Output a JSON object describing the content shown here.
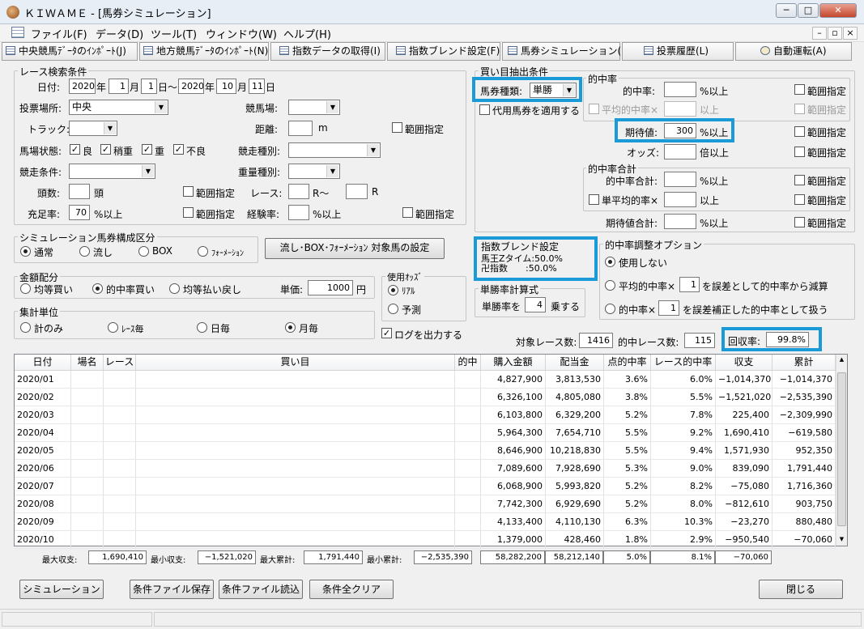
{
  "window": {
    "title": "ＫＩＷＡＭＥ - [馬券シミュレーション]",
    "minimize": "─",
    "maximize": "□",
    "close": "✕"
  },
  "menu": {
    "items": [
      "ファイル(F)",
      "データ(D)",
      "ツール(T)",
      "ウィンドウ(W)",
      "ヘルプ(H)"
    ],
    "mdi_min": "–",
    "mdi_restore": "▫",
    "mdi_close": "×"
  },
  "toolbar": {
    "items": [
      "中央競馬ﾃﾞｰﾀのｲﾝﾎﾟｰﾄ(J)",
      "地方競馬ﾃﾞｰﾀのｲﾝﾎﾟｰﾄ(N)",
      "指数データの取得(I)",
      "指数ブレンド設定(F)",
      "馬券シミュレーション(B)",
      "投票履歴(L)",
      "自動運転(A)"
    ]
  },
  "race_search": {
    "title": "レース検索条件",
    "date_label": "日付:",
    "from_year": "2020",
    "from_month": "1",
    "from_day": "1",
    "to_year": "2020",
    "to_month": "10",
    "to_day": "11",
    "year": "年",
    "month": "月",
    "day_from": "日～",
    "day": "日",
    "venue_label": "投票場所:",
    "venue": "中央",
    "course_label": "競馬場:",
    "course": "",
    "track_label": "トラック:",
    "track": "",
    "distance_label": "距離:",
    "distance": "",
    "distance_unit": "m",
    "range": "範囲指定",
    "condition_label": "馬場状態:",
    "conditions": [
      {
        "label": "良",
        "checked": true
      },
      {
        "label": "稍重",
        "checked": true
      },
      {
        "label": "重",
        "checked": true
      },
      {
        "label": "不良",
        "checked": true
      }
    ],
    "race_type_label": "競走種別:",
    "race_type": "",
    "race_cond_label": "競走条件:",
    "race_cond": "",
    "weight_label": "重量種別:",
    "weight": "",
    "heads_label": "頭数:",
    "heads": "",
    "heads_unit": "頭",
    "race_label": "レース:",
    "race_from": "",
    "race_r1": "R～",
    "race_to": "",
    "race_r2": "R",
    "fill_label": "充足率:",
    "fill": "70",
    "fill_unit": "%以上",
    "exp_label": "経験率:",
    "exp": "",
    "exp_unit": "%以上"
  },
  "sim_type": {
    "title": "シミュレーション馬券構成区分",
    "options": [
      "通常",
      "流し",
      "BOX",
      "ﾌｫｰﾒｰｼｮﾝ"
    ],
    "selected": 0,
    "setting_button": "流し･BOX･ﾌｫｰﾒｰｼｮﾝ 対象馬の設定"
  },
  "allocation": {
    "title": "金額配分",
    "options": [
      "均等買い",
      "的中率買い",
      "均等払い戻し"
    ],
    "selected": 1,
    "unit_label": "単価:",
    "unit_value": "1000",
    "unit": "円"
  },
  "odds": {
    "title": "使用ｵｯｽﾞ",
    "options": [
      "ﾘｱﾙ",
      "予測"
    ],
    "selected": 0
  },
  "aggregate": {
    "title": "集計単位",
    "options": [
      "計のみ",
      "ﾚｰｽ毎",
      "日毎",
      "月毎"
    ],
    "selected": 3
  },
  "log": {
    "label": "ログを出力する",
    "checked": true
  },
  "buy": {
    "title": "買い目抽出条件",
    "type_label": "馬券種類:",
    "type": "単勝",
    "substitute": "代用馬券を適用する",
    "hit_group": "的中率",
    "hit_label": "的中率:",
    "pct_over": "%以上",
    "avg_hit": "平均的中率×",
    "over": "以上",
    "ev_label": "期待値:",
    "ev": "300",
    "odds_label": "オッズ:",
    "odds_unit": "倍以上",
    "sum_group": "的中率合計",
    "hit_sum_label": "的中率合計:",
    "single_avg": "単平均的率×",
    "ev_sum_label": "期待値合計:",
    "range": "範囲指定"
  },
  "blend": {
    "title": "指数ブレンド設定",
    "lines": [
      "馬王Zタイム:50.0%",
      "卍指数　　:50.0%"
    ]
  },
  "formula": {
    "title": "単勝率計算式",
    "label": "単勝率を",
    "value": "4",
    "unit": "乗する"
  },
  "adjust": {
    "title": "的中率調整オプション",
    "opt0": "使用しない",
    "opt1a": "平均的中率×",
    "opt1v": "1",
    "opt1b": "を誤差として的中率から減算",
    "opt2a": "的中率×",
    "opt2v": "1",
    "opt2b": "を誤差補正した的中率として扱う",
    "selected": 0
  },
  "result": {
    "target_label": "対象レース数:",
    "target": "1416",
    "hit_label": "的中レース数:",
    "hit": "115",
    "recovery_label": "回収率:",
    "recovery": "99.8%"
  },
  "table": {
    "columns": [
      "日付",
      "場名",
      "レース",
      "買い目",
      "的中",
      "購入金額",
      "配当金",
      "点的中率",
      "レース的中率",
      "収支",
      "累計"
    ],
    "rows": [
      [
        "2020/01",
        "",
        "",
        "",
        "",
        "4,827,900",
        "3,813,530",
        "3.6%",
        "6.0%",
        "−1,014,370",
        "−1,014,370"
      ],
      [
        "2020/02",
        "",
        "",
        "",
        "",
        "6,326,100",
        "4,805,080",
        "3.8%",
        "5.5%",
        "−1,521,020",
        "−2,535,390"
      ],
      [
        "2020/03",
        "",
        "",
        "",
        "",
        "6,103,800",
        "6,329,200",
        "5.2%",
        "7.8%",
        "225,400",
        "−2,309,990"
      ],
      [
        "2020/04",
        "",
        "",
        "",
        "",
        "5,964,300",
        "7,654,710",
        "5.5%",
        "9.2%",
        "1,690,410",
        "−619,580"
      ],
      [
        "2020/05",
        "",
        "",
        "",
        "",
        "8,646,900",
        "10,218,830",
        "5.5%",
        "9.4%",
        "1,571,930",
        "952,350"
      ],
      [
        "2020/06",
        "",
        "",
        "",
        "",
        "7,089,600",
        "7,928,690",
        "5.3%",
        "9.0%",
        "839,090",
        "1,791,440"
      ],
      [
        "2020/07",
        "",
        "",
        "",
        "",
        "6,068,900",
        "5,993,820",
        "5.2%",
        "8.2%",
        "−75,080",
        "1,716,360"
      ],
      [
        "2020/08",
        "",
        "",
        "",
        "",
        "7,742,300",
        "6,929,690",
        "5.2%",
        "8.0%",
        "−812,610",
        "903,750"
      ],
      [
        "2020/09",
        "",
        "",
        "",
        "",
        "4,133,400",
        "4,110,130",
        "6.3%",
        "10.3%",
        "−23,270",
        "880,480"
      ],
      [
        "2020/10",
        "",
        "",
        "",
        "",
        "1,379,000",
        "428,460",
        "1.8%",
        "2.9%",
        "−950,540",
        "−70,060"
      ]
    ]
  },
  "summary": {
    "max_label": "最大収支:",
    "max": "1,690,410",
    "min_label": "最小収支:",
    "min": "−1,521,020",
    "max_cum_label": "最大累計:",
    "max_cum": "1,791,440",
    "min_cum_label": "最小累計:",
    "min_cum": "−2,535,390",
    "buy": "58,282,200",
    "pay": "58,212,140",
    "pt": "5.0%",
    "race": "8.1%",
    "bal": "−70,060"
  },
  "buttons": {
    "simulate": "シミュレーション",
    "save": "条件ファイル保存",
    "load": "条件ファイル読込",
    "clear": "条件全クリア",
    "close": "閉じる"
  },
  "colors": {
    "highlight": "#1a9ad6",
    "title_bg": "#e8eef6"
  }
}
